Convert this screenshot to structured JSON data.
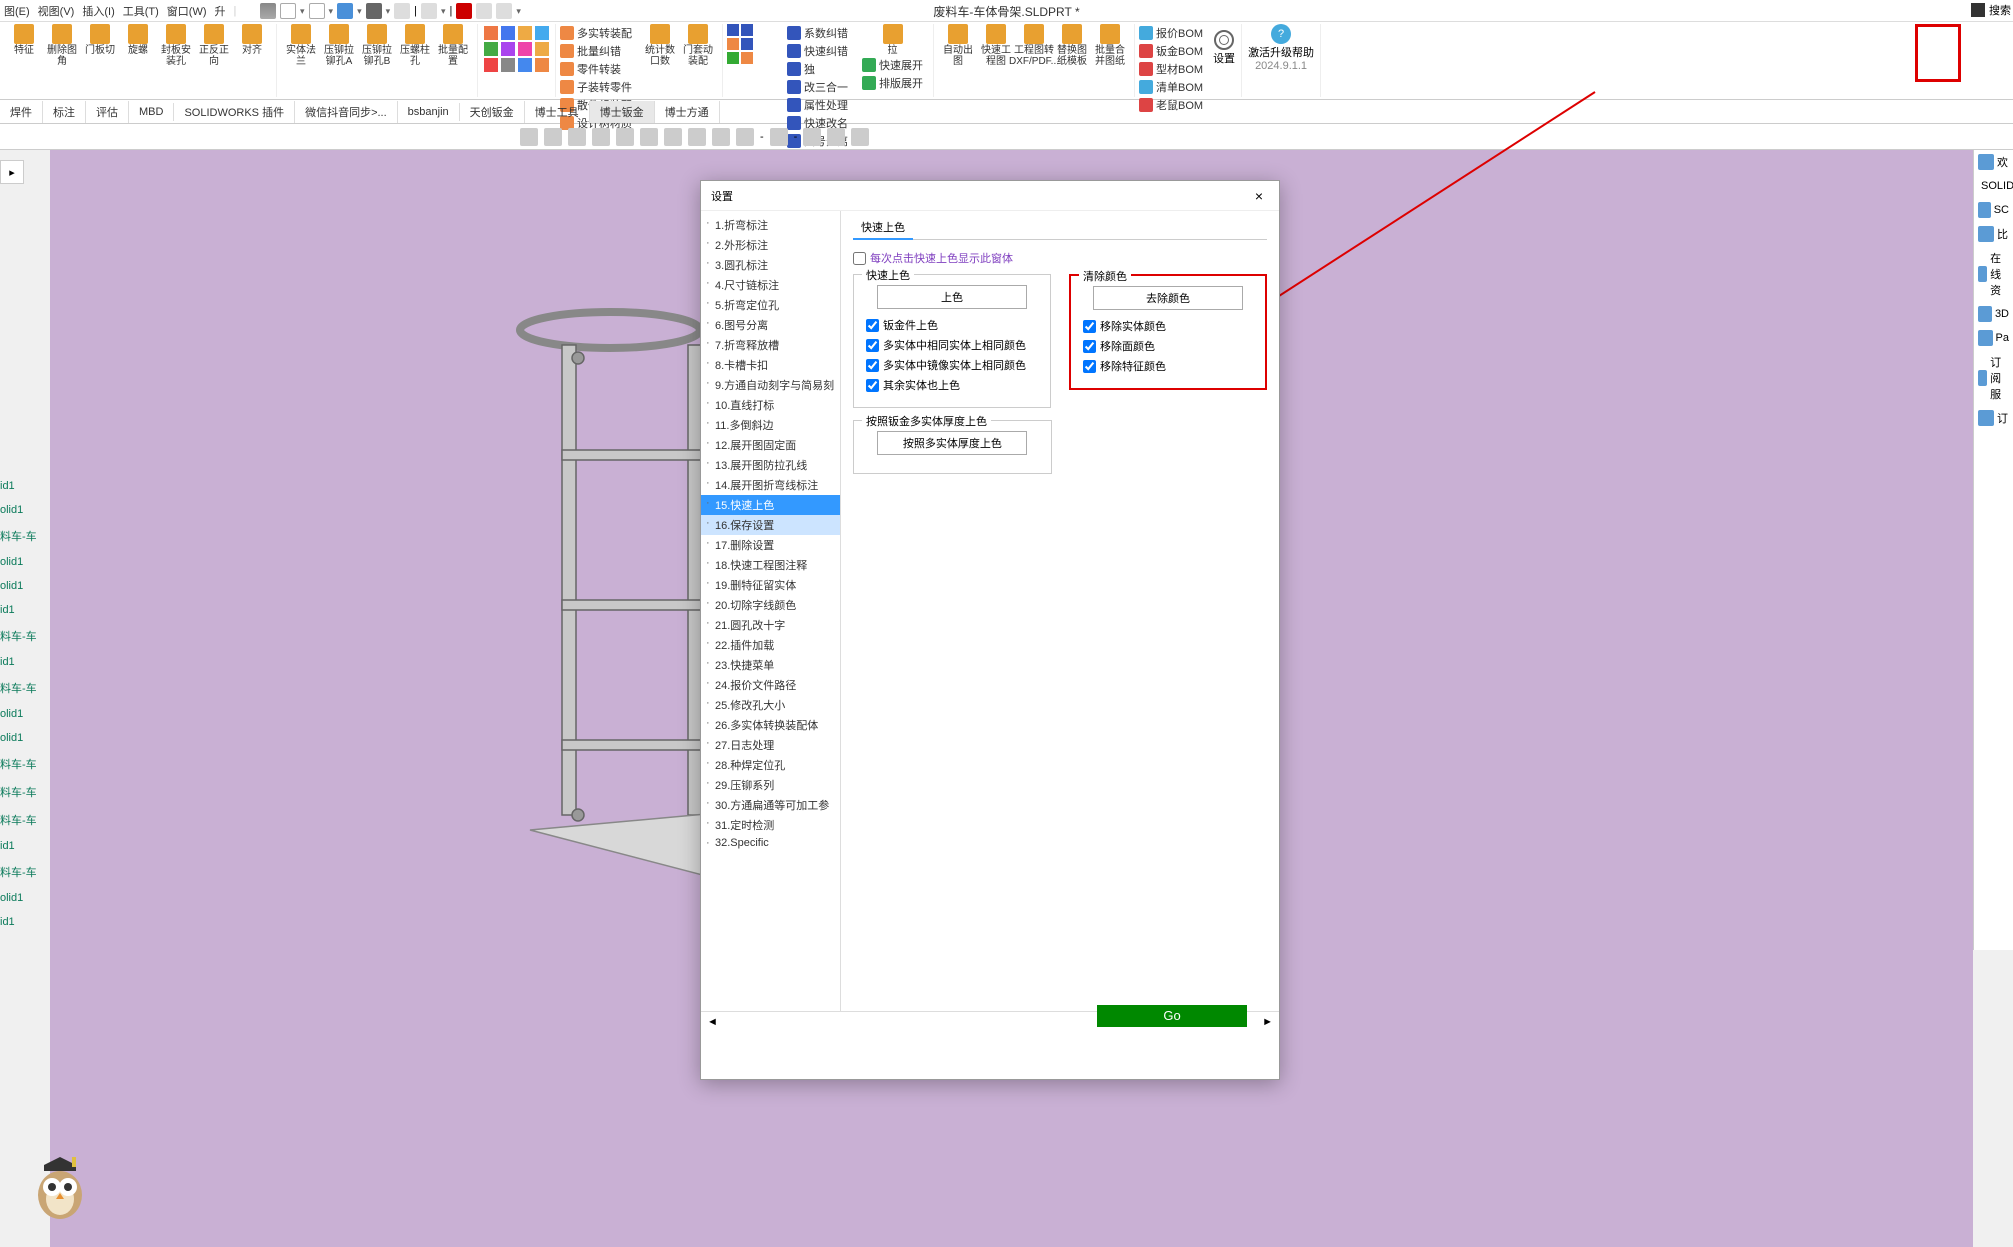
{
  "title": "废料车-车体骨架.SLDPRT *",
  "menubar": [
    "图(E)",
    "视图(V)",
    "插入(I)",
    "工具(T)",
    "窗口(W)",
    "升"
  ],
  "search_placeholder": "搜索",
  "version_label": "2024.9.1.1",
  "ribbon": {
    "g1": [
      {
        "lbl": "特征"
      },
      {
        "lbl": "删除图角"
      },
      {
        "lbl": "门板切"
      },
      {
        "lbl": "旋螺"
      },
      {
        "lbl": "封板安装孔"
      },
      {
        "lbl": "正反正向"
      },
      {
        "lbl": "对齐"
      }
    ],
    "g2": [
      {
        "lbl": "实体法兰"
      },
      {
        "lbl": "压铆拉铆孔A"
      },
      {
        "lbl": "压铆拉铆孔B"
      },
      {
        "lbl": "压螺柱孔"
      },
      {
        "lbl": "批量配置"
      }
    ],
    "g3_small": [
      "多实转装配",
      "批量纠错",
      "零件转装",
      "子装转零件",
      "散件组装配",
      "设计树材质"
    ],
    "g4": [
      {
        "lbl": "统计数口数"
      },
      {
        "lbl": "门套动装配"
      }
    ],
    "g5_small": [
      "系数纠错",
      "快速纠错",
      "独",
      "改三合一",
      "属性处理",
      "快速改名",
      "图号分离"
    ],
    "g6": [
      {
        "lbl": "拉"
      }
    ],
    "g6_small": [
      "快速展开",
      "排版展开"
    ],
    "g7": [
      {
        "lbl": "自动出图"
      },
      {
        "lbl": "快速工程图"
      },
      {
        "lbl": "工程图转DXF/PDF..."
      },
      {
        "lbl": "替换图纸模板"
      },
      {
        "lbl": "批量合并图纸"
      }
    ],
    "g8_small": [
      "报价BOM",
      "钣金BOM",
      "型材BOM",
      "清单BOM",
      "老鼠BOM"
    ],
    "settings_lbl": "设置",
    "help_lbl": "激活升级帮助"
  },
  "tabs": [
    "焊件",
    "标注",
    "评估",
    "MBD",
    "SOLIDWORKS 插件",
    "微信抖音同步>...",
    "bsbanjin",
    "天创钣金",
    "博士工具",
    "博士钣金",
    "博士方通"
  ],
  "left_stubs": [
    "id1",
    "olid1",
    "料车-车",
    "olid1",
    "olid1",
    "id1",
    "料车-车",
    "id1",
    "料车-车",
    "olid1",
    "olid1",
    "料车-车",
    "料车-车",
    "料车-车",
    "id1",
    "料车-车",
    "olid1",
    "id1"
  ],
  "right_panel": [
    "欢",
    "SOLIDW",
    "SC",
    "比",
    "在线资",
    "3D",
    "Pa",
    "订阅服",
    "订"
  ],
  "dialog": {
    "title": "设置",
    "close": "×",
    "tree": [
      "1.折弯标注",
      "2.外形标注",
      "3.圆孔标注",
      "4.尺寸链标注",
      "5.折弯定位孔",
      "6.图号分离",
      "7.折弯释放槽",
      "8.卡槽卡扣",
      "9.方通自动刻字与简易刻",
      "10.直线打标",
      "11.多倒斜边",
      "12.展开图固定面",
      "13.展开图防拉孔线",
      "14.展开图折弯线标注",
      "15.快速上色",
      "16.保存设置",
      "17.删除设置",
      "18.快速工程图注释",
      "19.删特征留实体",
      "20.切除字线颜色",
      "21.圆孔改十字",
      "22.插件加载",
      "23.快捷菜单",
      "24.报价文件路径",
      "25.修改孔大小",
      "26.多实体转换装配体",
      "27.日志处理",
      "28.种焊定位孔",
      "29.压铆系列",
      "30.方通扁通等可加工参",
      "31.定时检测",
      "32.Specific"
    ],
    "tree_selected": 14,
    "tree_highlight": 15,
    "content_tab": "快速上色",
    "always_show": "每次点击快速上色显示此窗体",
    "fs1": {
      "legend": "快速上色",
      "btn": "上色",
      "chks": [
        "钣金件上色",
        "多实体中相同实体上相同颜色",
        "多实体中镜像实体上相同颜色",
        "其余实体也上色"
      ]
    },
    "fs2": {
      "legend": "清除颜色",
      "btn": "去除颜色",
      "chks": [
        "移除实体颜色",
        "移除面颜色",
        "移除特征颜色"
      ]
    },
    "fs3": {
      "legend": "按照钣金多实体厚度上色",
      "btn": "按照多实体厚度上色"
    },
    "go": "Go"
  }
}
